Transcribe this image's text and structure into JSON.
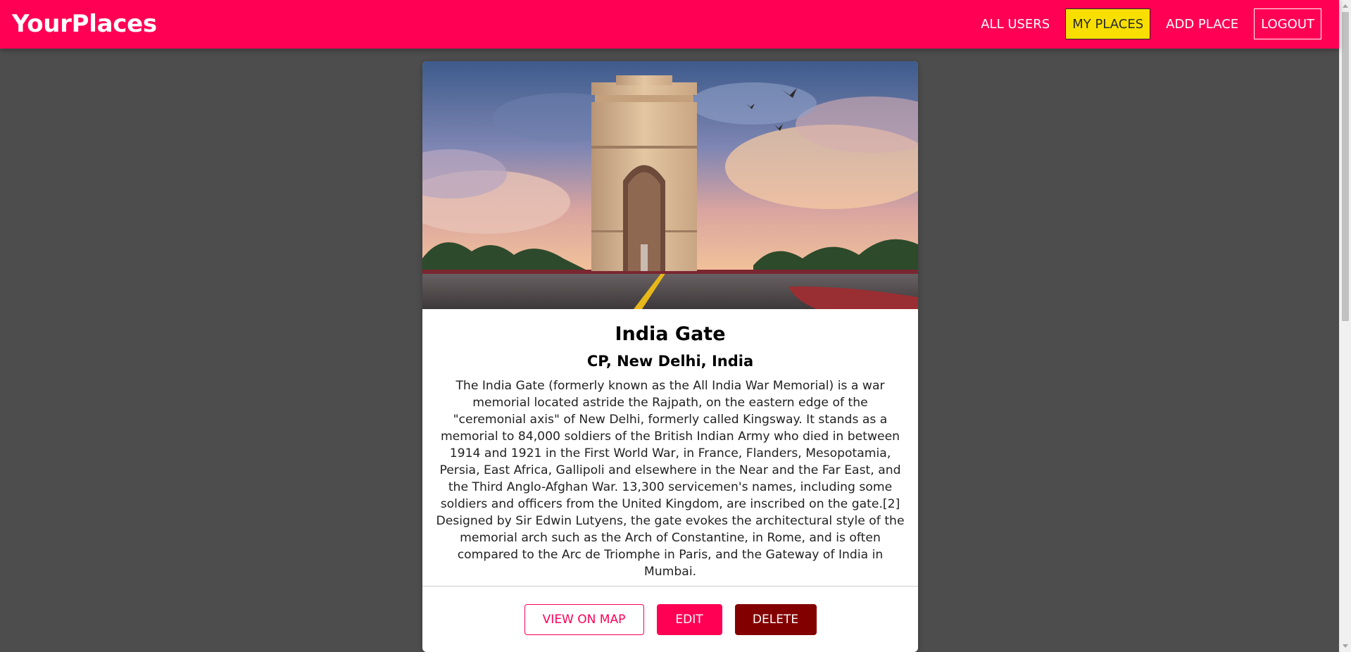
{
  "app": {
    "title": "YourPlaces"
  },
  "nav": {
    "items": [
      {
        "label": "ALL USERS",
        "active": false
      },
      {
        "label": "MY PLACES",
        "active": true
      },
      {
        "label": "ADD PLACE",
        "active": false
      },
      {
        "label": "LOGOUT",
        "active": false
      }
    ]
  },
  "place": {
    "title": "India Gate",
    "address": "CP, New Delhi, India",
    "description": "The India Gate (formerly known as the All India War Memorial) is a war memorial located astride the Rajpath, on the eastern edge of the \"ceremonial axis\" of New Delhi, formerly called Kingsway. It stands as a memorial to 84,000 soldiers of the British Indian Army who died in between 1914 and 1921 in the First World War, in France, Flanders, Mesopotamia, Persia, East Africa, Gallipoli and elsewhere in the Near and the Far East, and the Third Anglo-Afghan War. 13,300 servicemen's names, including some soldiers and officers from the United Kingdom, are inscribed on the gate.[2] Designed by Sir Edwin Lutyens, the gate evokes the architectural style of the memorial arch such as the Arch of Constantine, in Rome, and is often compared to the Arc de Triomphe in Paris, and the Gateway of India in Mumbai.",
    "image_subject": "India Gate photo"
  },
  "actions": {
    "view_on_map": "VIEW ON MAP",
    "edit": "EDIT",
    "delete": "DELETE"
  },
  "colors": {
    "primary": "#ff0055",
    "active_nav": "#f8df00",
    "danger": "#830000",
    "background": "#4d4d4d"
  }
}
